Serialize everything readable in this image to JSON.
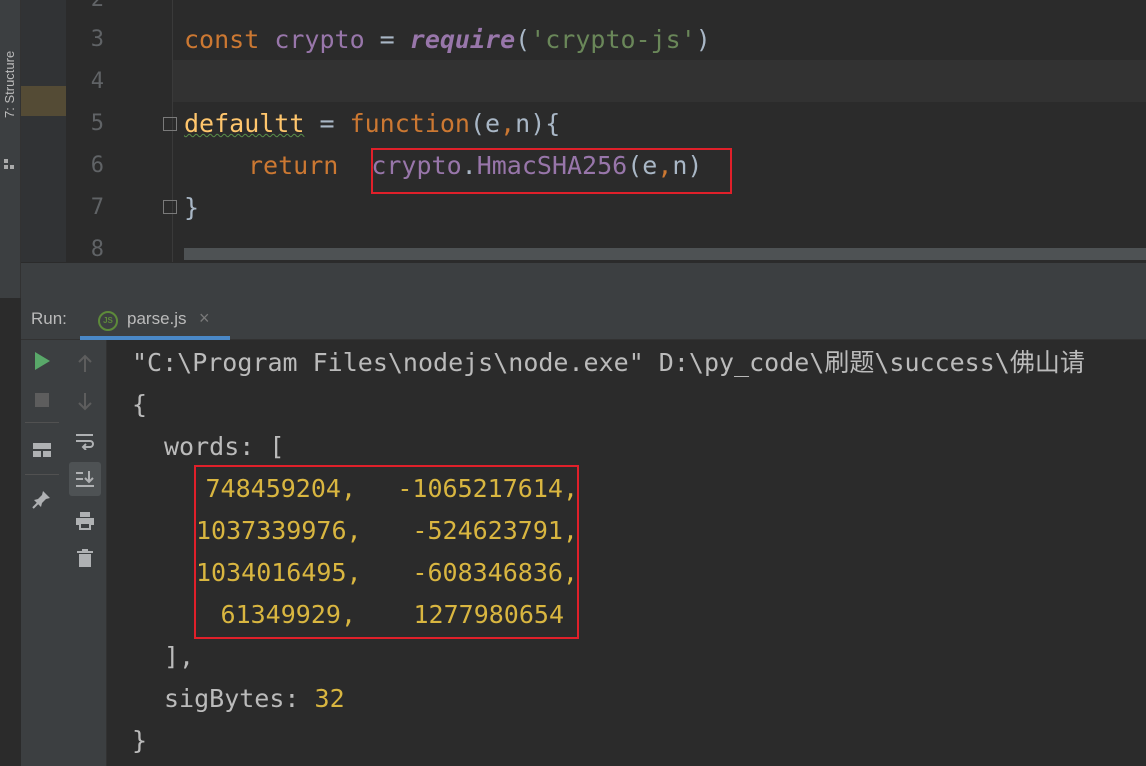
{
  "sidebar": {
    "structure_label": "7: Structure"
  },
  "editor": {
    "line_numbers": [
      "2",
      "3",
      "4",
      "5",
      "6",
      "7",
      "8"
    ],
    "lines": {
      "l3": {
        "t1": "const ",
        "t2": "crypto",
        "t3": " = ",
        "t4": "require",
        "t5": "(",
        "t6": "'crypto-js'",
        "t7": ")"
      },
      "l5": {
        "t1": "defaultt",
        "t2": " = ",
        "t3": "function",
        "t4": "(e",
        "t5": ",",
        "t6": "n){"
      },
      "l6": {
        "t1": "return",
        "t2": "crypto",
        "t3": ".",
        "t4": "HmacSHA256",
        "t5": "(e",
        "t6": ",",
        "t7": "n)"
      },
      "l7": {
        "t1": "}"
      }
    }
  },
  "run": {
    "label": "Run:",
    "tab_name": "parse.js",
    "tab_icon_text": "JS",
    "close_glyph": "×"
  },
  "console": {
    "command": "\"C:\\Program Files\\nodejs\\node.exe\" D:\\py_code\\刷题\\success\\佛山请",
    "open_brace": "{",
    "words_label": "words: [",
    "words_rows": [
      [
        "748459204,",
        "-1065217614,"
      ],
      [
        "1037339976,",
        "-524623791,"
      ],
      [
        "1034016495,",
        "-608346836,"
      ],
      [
        "61349929,",
        "1277980654"
      ]
    ],
    "close_bracket": "],",
    "sigbytes_label": "sigBytes: ",
    "sigbytes_value": "32",
    "close_brace": "}"
  },
  "colors": {
    "keyword": "#cc7832",
    "string": "#6a8759",
    "number": "#d9b640",
    "highlight_box": "#e0202a",
    "run_icon": "#59a869"
  }
}
